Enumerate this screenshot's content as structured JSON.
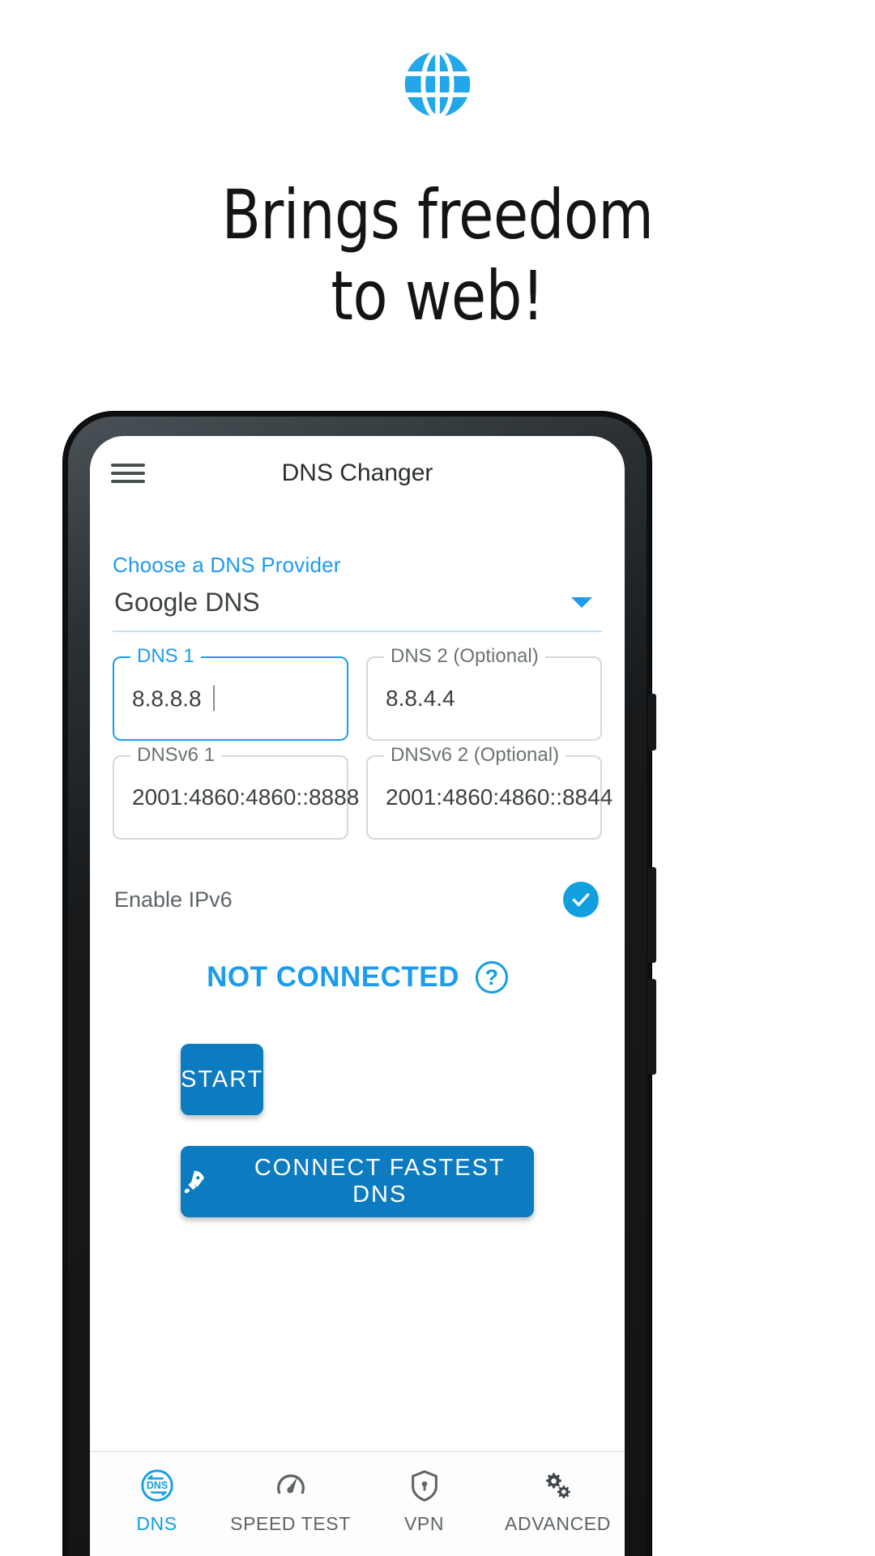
{
  "promo": {
    "icon": "globe-icon",
    "headline_line1": "Brings freedom",
    "headline_line2": "to web!",
    "accent_color": "#1d9bee"
  },
  "app": {
    "appbar": {
      "menu_icon": "hamburger-menu-icon",
      "title": "DNS Changer"
    },
    "provider": {
      "label": "Choose a DNS Provider",
      "selected": "Google DNS",
      "caret_icon": "chevron-down-icon"
    },
    "fields": [
      {
        "legend": "DNS 1",
        "value": "8.8.8.8",
        "focused": true
      },
      {
        "legend": "DNS 2 (Optional)",
        "value": "8.8.4.4",
        "focused": false
      },
      {
        "legend": "DNSv6 1",
        "value": "2001:4860:4860::8888",
        "focused": false
      },
      {
        "legend": "DNSv6 2 (Optional)",
        "value": "2001:4860:4860::8844",
        "focused": false
      }
    ],
    "ipv6": {
      "label": "Enable IPv6",
      "checked": true,
      "check_icon": "checkmark-icon"
    },
    "status": {
      "text": "NOT CONNECTED",
      "help_icon": "question-mark-icon",
      "help_label": "?",
      "color": "#1d9bee"
    },
    "buttons": {
      "start": "START",
      "fastest": "CONNECT FASTEST DNS",
      "fastest_icon": "rocket-icon",
      "color": "#0d7bc0"
    },
    "bottom_nav": [
      {
        "label": "DNS",
        "icon": "dns-icon",
        "active": true
      },
      {
        "label": "SPEED TEST",
        "icon": "speedometer-icon",
        "active": false
      },
      {
        "label": "VPN",
        "icon": "shield-lock-icon",
        "active": false
      },
      {
        "label": "ADVANCED",
        "icon": "gears-icon",
        "active": false
      }
    ]
  }
}
